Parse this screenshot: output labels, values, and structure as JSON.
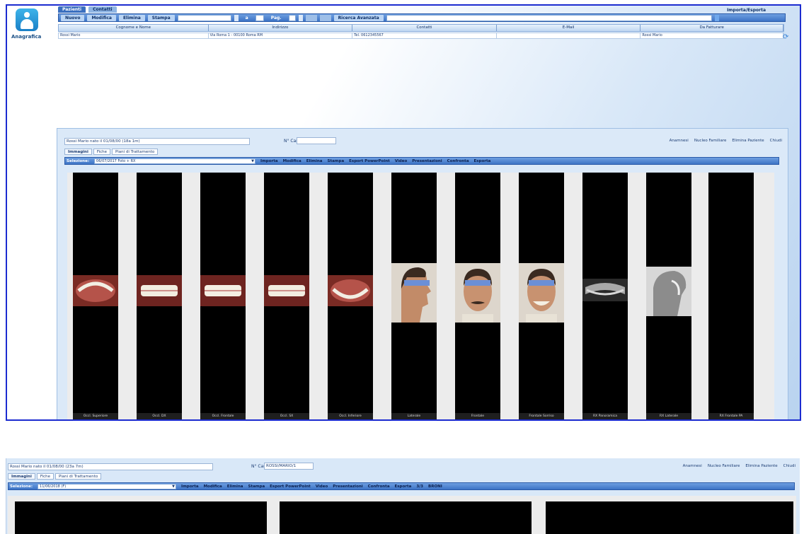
{
  "app": {
    "title": "Anagrafica",
    "tabs": [
      "Pazienti",
      "Contatti"
    ],
    "import_export": "Importa/Esporta"
  },
  "toolbar": {
    "buttons": [
      "Nuovo",
      "Modifica",
      "Elimina",
      "Stampa"
    ],
    "range_sep": "a",
    "page_label": "Pag.",
    "search_button": "Ricerca Avanzata"
  },
  "patient_table": {
    "columns": [
      "Cognome e Nome",
      "Indirizzo",
      "Contatti",
      "E-Mail",
      "Da Fatturare"
    ],
    "row": [
      "Rossi Mario",
      "Via Roma 1 - 00100 Roma RM",
      "Tel. 0612345567",
      "",
      "Rossi Mario"
    ]
  },
  "card1": {
    "patient_name": "Rossi Mario nato il 01/08/00 (18a 1m)",
    "cartella_label": "N° Cartella",
    "cartella_value": "",
    "right_links": [
      "Anamnesi",
      "Nucleo Familiare",
      "Elimina Paziente",
      "Chiudi"
    ],
    "tabs": [
      "Immagini",
      "Fiche",
      "Piani di Trattamento"
    ],
    "toolbar_label": "Selezione:",
    "select_value": "06/07/2017 Foto + RX",
    "actions": [
      "Importa",
      "Modifica",
      "Elimina",
      "Stampa",
      "Esport PowerPoint",
      "Video",
      "Presentazioni",
      "Confronta",
      "Esporta"
    ],
    "photos": [
      {
        "caption": "Occl. Superiore",
        "kind": "teeth"
      },
      {
        "caption": "Occl. DX",
        "kind": "teeth"
      },
      {
        "caption": "Occl. Frontale",
        "kind": "teeth"
      },
      {
        "caption": "Occl. SX",
        "kind": "teeth"
      },
      {
        "caption": "Occl. Inferiore",
        "kind": "teeth-lower"
      },
      {
        "caption": "Laterale",
        "kind": "face-side"
      },
      {
        "caption": "Frontale",
        "kind": "face"
      },
      {
        "caption": "Frontale Sorriso",
        "kind": "face"
      },
      {
        "caption": "RX Panoramica",
        "kind": "xray-pan"
      },
      {
        "caption": "RX Laterale",
        "kind": "xray-lat"
      },
      {
        "caption": "RX Frontale PA",
        "kind": "empty"
      }
    ]
  },
  "card2": {
    "patient_name": "Rossi Mario nato il 01/08/00 (23a 7m)",
    "cartella_label": "N° Cartella",
    "cartella_value": "ROSSI/MARIO/1",
    "right_links": [
      "Anamnesi",
      "Nucleo Familiare",
      "Elimina Paziente",
      "Chiudi"
    ],
    "tabs": [
      "Immagini",
      "Fiche",
      "Piani di Trattamento"
    ],
    "toolbar_label": "Selezione:",
    "select_value": "11/06/2018 (F)",
    "actions": [
      "Importa",
      "Modifica",
      "Elimina",
      "Stampa",
      "Esport PowerPoint",
      "Video",
      "Presentazioni",
      "Confronta",
      "Esporta",
      "3/3",
      "BRONI"
    ]
  }
}
